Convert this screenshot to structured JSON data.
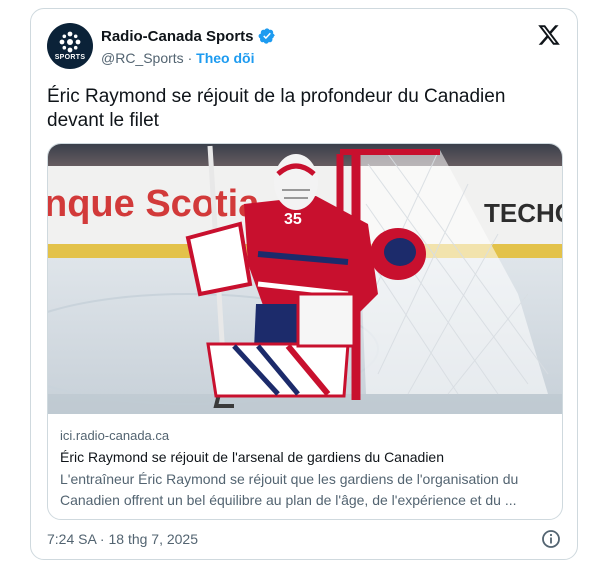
{
  "account": {
    "display_name": "Radio-Canada Sports",
    "handle": "@RC_Sports",
    "separator": "·",
    "follow_label": "Theo dõi",
    "avatar_text": "SPORTS"
  },
  "tweet": {
    "text": "Éric Raymond se réjouit de la profondeur du Canadien devant le filet",
    "timestamp": "7:24 SA · 18 thg 7, 2025"
  },
  "link_card": {
    "domain": "ici.radio-canada.ca",
    "title": "Éric Raymond se réjouit de l'arsenal de gardiens du Canadien",
    "description": "L'entraîneur Éric Raymond se réjouit que les gardiens de l'organisation du Canadien offrent un bel équilibre au plan de l'âge, de l'expérience et du ..."
  },
  "photo": {
    "board_text_left": "nque Scotia",
    "board_text_right": "TECHO",
    "jersey_number": "35"
  },
  "colors": {
    "brand_dark": "#0b2238",
    "link_blue": "#1d9bf0",
    "muted": "#536471",
    "canadiens_red": "#c8102e"
  },
  "icons": [
    "verified-badge-icon",
    "x-logo-icon",
    "info-icon"
  ]
}
